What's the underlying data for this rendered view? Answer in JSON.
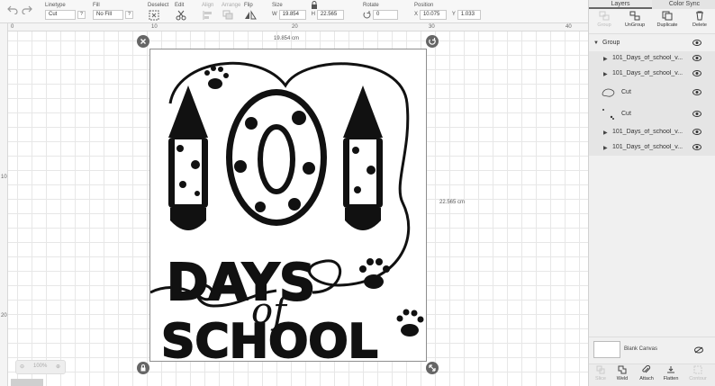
{
  "toolbar": {
    "undo_icon": "undo-icon",
    "redo_icon": "redo-icon",
    "linetype": {
      "label": "Linetype",
      "value": "Cut"
    },
    "fill": {
      "label": "Fill",
      "value": "No Fill"
    },
    "deselect_label": "Deselect",
    "edit_label": "Edit",
    "align_label": "Align",
    "arrange_label": "Arrange",
    "flip_label": "Flip",
    "size": {
      "label": "Size",
      "w_label": "W",
      "w_value": "19.854",
      "h_label": "H",
      "h_value": "22.565"
    },
    "rotate": {
      "label": "Rotate",
      "value": "0"
    },
    "position": {
      "label": "Position",
      "x_label": "X",
      "x_value": "10.075",
      "y_label": "Y",
      "y_value": "1.033"
    }
  },
  "canvas": {
    "ruler_top": [
      "0",
      "10",
      "20",
      "30",
      "40"
    ],
    "ruler_left": [
      "10",
      "20"
    ],
    "width_label": "19.854 cm",
    "height_label": "22.565 cm",
    "zoom": "100%",
    "artwork": {
      "line1": "DAYS",
      "line2": "of",
      "line3": "SCHOOL"
    }
  },
  "panel": {
    "tabs": [
      {
        "label": "Layers",
        "active": true
      },
      {
        "label": "Color Sync",
        "active": false
      }
    ],
    "actions": [
      {
        "label": "Group",
        "enabled": false
      },
      {
        "label": "UnGroup",
        "enabled": true
      },
      {
        "label": "Duplicate",
        "enabled": true
      },
      {
        "label": "Delete",
        "enabled": true
      }
    ],
    "layers": [
      {
        "name": "Group",
        "level": 0
      },
      {
        "name": "101_Days_of_school_v...",
        "level": 1
      },
      {
        "name": "101_Days_of_school_v...",
        "level": 1
      },
      {
        "name": "Cut",
        "level": 1,
        "thumb": true
      },
      {
        "name": "Cut",
        "level": 1,
        "thumb": true
      },
      {
        "name": "101_Days_of_school_v...",
        "level": 1
      },
      {
        "name": "101_Days_of_school_v...",
        "level": 1
      }
    ],
    "blank_canvas": "Blank Canvas",
    "bottom_actions": [
      {
        "label": "Slice",
        "enabled": false
      },
      {
        "label": "Weld",
        "enabled": true
      },
      {
        "label": "Attach",
        "enabled": true
      },
      {
        "label": "Flatten",
        "enabled": true
      },
      {
        "label": "Contour",
        "enabled": false
      }
    ]
  }
}
